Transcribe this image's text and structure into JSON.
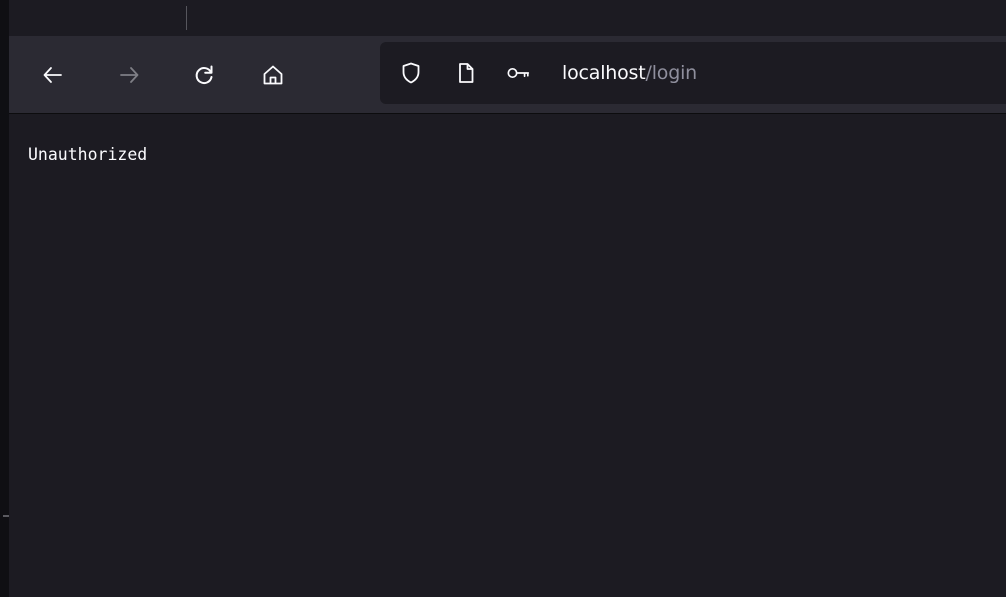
{
  "toolbar": {
    "back_icon": "arrow-left-icon",
    "forward_icon": "arrow-right-icon",
    "reload_icon": "reload-icon",
    "home_icon": "home-icon"
  },
  "urlbar": {
    "host": "localhost",
    "path": "/login",
    "icons": [
      "shield-icon",
      "page-icon",
      "key-icon"
    ]
  },
  "page": {
    "body_text": "Unauthorized"
  },
  "colors": {
    "toolbar_bg": "#2b2a33",
    "page_bg": "#1c1b22",
    "text": "#fbfbfe",
    "muted_text": "#8f8f9d"
  }
}
